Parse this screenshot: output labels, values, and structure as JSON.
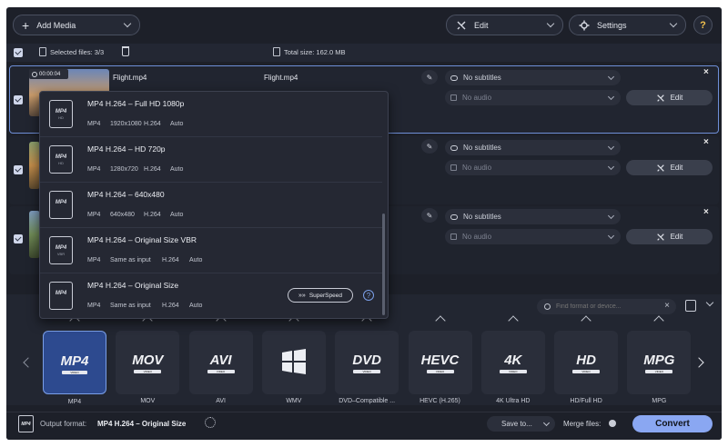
{
  "toolbar": {
    "add_media": "Add Media",
    "edit": "Edit",
    "settings": "Settings",
    "help": "?"
  },
  "filebar": {
    "selected": "Selected files: 3/3",
    "total_size": "Total size: 162.0 MB"
  },
  "files": [
    {
      "duration": "00:00:04",
      "name": "Flight.mp4",
      "output_name": "Flight.mp4",
      "subtitles": "No subtitles",
      "audio": "No audio",
      "edit": "Edit"
    },
    {
      "subtitles": "No subtitles",
      "audio": "No audio",
      "edit": "Edit"
    },
    {
      "subtitles": "No subtitles",
      "audio": "No audio",
      "edit": "Edit"
    }
  ],
  "menu": {
    "items": [
      {
        "icon_top": "MP4",
        "icon_sub": "HD",
        "name": "MP4 H.264 – Full HD 1080p",
        "specs": [
          "MP4",
          "1920x1080",
          "H.264",
          "Auto"
        ]
      },
      {
        "icon_top": "MP4",
        "icon_sub": "HD",
        "name": "MP4 H.264 – HD 720p",
        "specs": [
          "MP4",
          "1280x720",
          "H.264",
          "Auto"
        ]
      },
      {
        "icon_top": "MP4",
        "icon_sub": "",
        "name": "MP4 H.264 – 640x480",
        "specs": [
          "MP4",
          "640x480",
          "H.264",
          "Auto"
        ]
      },
      {
        "icon_top": "MP4",
        "icon_sub": "VBR",
        "name": "MP4 H.264 – Original Size VBR",
        "specs": [
          "MP4",
          "Same as input",
          "H.264",
          "Auto"
        ]
      },
      {
        "icon_top": "MP4",
        "icon_sub": "",
        "name": "MP4 H.264 – Original Size",
        "specs": [
          "MP4",
          "Same as input",
          "H.264",
          "Auto"
        ]
      }
    ],
    "superspeed": "SuperSpeed"
  },
  "search": {
    "placeholder": "Find format or device..."
  },
  "formats": [
    {
      "logo": "MP4",
      "sub": "VIDEO",
      "label": "MP4"
    },
    {
      "logo": "MOV",
      "sub": "VIDEO",
      "label": "MOV"
    },
    {
      "logo": "AVI",
      "sub": "VIDEO",
      "label": "AVI"
    },
    {
      "logo": "",
      "sub": "",
      "label": "WMV"
    },
    {
      "logo": "DVD",
      "sub": "VIDEO",
      "label": "DVD–Compatible ..."
    },
    {
      "logo": "HEVC",
      "sub": "VIDEO",
      "label": "HEVC (H.265)"
    },
    {
      "logo": "4K",
      "sub": "VIDEO",
      "label": "4K Ultra HD"
    },
    {
      "logo": "HD",
      "sub": "VIDEO",
      "label": "HD/Full HD"
    },
    {
      "logo": "MPG",
      "sub": "VIDEO",
      "label": "MPG"
    }
  ],
  "bottom": {
    "format_icon": "MP4",
    "output_label": "Output format:",
    "output_value": "MP4 H.264 – Original Size",
    "save_to": "Save to...",
    "merge": "Merge files:",
    "convert": "Convert"
  },
  "colors": {
    "accent": "#7b9fe8",
    "convert": "#8aa7f2",
    "background": "#1d2029"
  }
}
